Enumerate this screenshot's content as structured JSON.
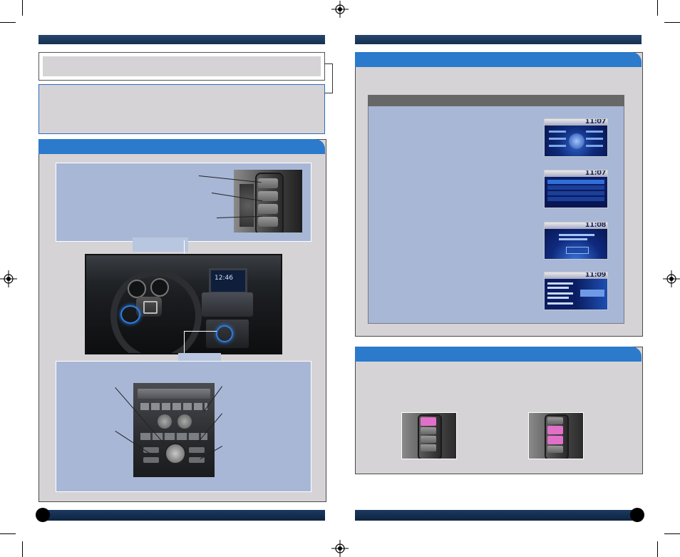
{
  "left_page": {
    "clock_display": "12:46",
    "sections": [
      "note-box",
      "info-box",
      "controls-panel"
    ]
  },
  "right_page": {
    "screens": [
      {
        "name": "settings",
        "time": "11:07"
      },
      {
        "name": "phone-settings",
        "time": "11:07"
      },
      {
        "name": "add-bluetooth-device",
        "time": "11:08"
      },
      {
        "name": "pairing-done",
        "time": "11:09"
      }
    ]
  },
  "colors": {
    "header_blue": "#2c7acc",
    "panel_blue": "#a8b7d6",
    "bar_navy": "#1b3a60",
    "box_gray": "#d6d3d6",
    "highlight_pink": "#e070c8"
  },
  "icons": [
    "registration-mark-icon",
    "crop-mark-icon"
  ]
}
